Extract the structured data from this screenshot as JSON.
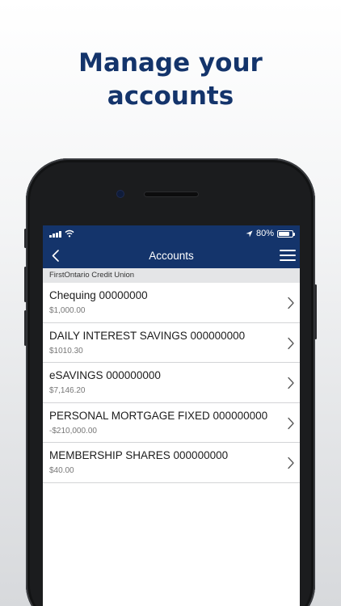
{
  "headline": {
    "line1": "Manage your",
    "line2": "accounts"
  },
  "status_bar": {
    "battery_text": "80%",
    "battery_level": 0.8
  },
  "nav": {
    "title": "Accounts"
  },
  "section": {
    "title": "FirstOntario Credit Union"
  },
  "accounts": [
    {
      "name": "Chequing 00000000",
      "balance": "$1,000.00"
    },
    {
      "name": "DAILY INTEREST SAVINGS 000000000",
      "balance": "$1010.30"
    },
    {
      "name": "eSAVINGS 000000000",
      "balance": "$7,146.20"
    },
    {
      "name": "PERSONAL MORTGAGE FIXED 000000000",
      "balance": "-$210,000.00"
    },
    {
      "name": "MEMBERSHIP SHARES 000000000",
      "balance": "$40.00"
    }
  ],
  "colors": {
    "brand": "#14346b",
    "section_bg": "#e4e5e7",
    "headline": "#14346b"
  },
  "icons": [
    "signal-icon",
    "wifi-icon",
    "location-arrow-icon",
    "battery-icon",
    "back-chevron-icon",
    "hamburger-menu-icon",
    "chevron-right-icon"
  ]
}
